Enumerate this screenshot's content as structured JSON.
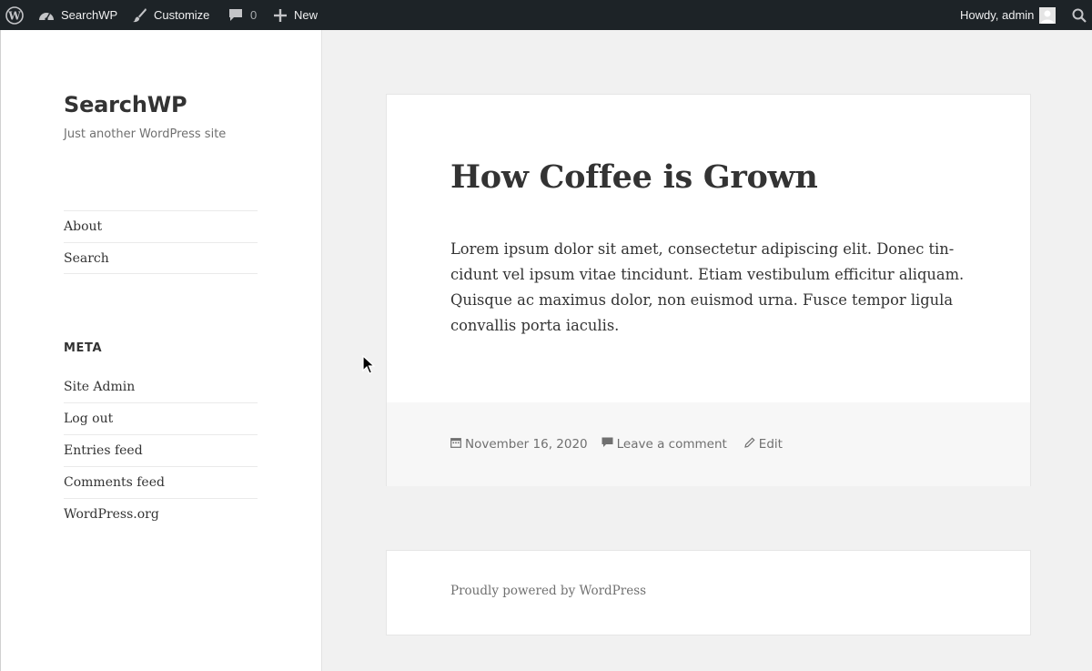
{
  "adminbar": {
    "site_name": "SearchWP",
    "customize": "Customize",
    "comments_count": "0",
    "new_label": "New",
    "greeting": "Howdy, admin",
    "icons": [
      "wordpress-logo-icon",
      "dashboard-icon",
      "brush-icon",
      "comment-bubble-icon",
      "plus-icon",
      "avatar",
      "search-icon"
    ]
  },
  "sidebar": {
    "site_title": "SearchWP",
    "tagline": "Just another WordPress site",
    "nav": [
      "About",
      "Search"
    ],
    "meta_title": "META",
    "meta_links": [
      "Site Admin",
      "Log out",
      "Entries feed",
      "Comments feed",
      "WordPress.org"
    ]
  },
  "post": {
    "title": "How Coffee is Grown",
    "body": "Lorem ipsum dolor sit amet, consectetur adipiscing elit. Donec tin-cidunt vel ipsum vitae tincidunt. Etiam vestibulum efficitur aliquam. Quisque ac maximus dolor, non euismod urna. Fusce tempor ligula convallis porta iaculis.",
    "date": "November 16, 2020",
    "comment_link": "Leave a comment",
    "edit_link": "Edit"
  },
  "footer": {
    "powered": "Proudly powered by WordPress"
  },
  "colors": {
    "adminbar_bg": "#1d2327",
    "page_bg": "#f1f1f1",
    "text": "#333333",
    "muted": "#707070"
  }
}
